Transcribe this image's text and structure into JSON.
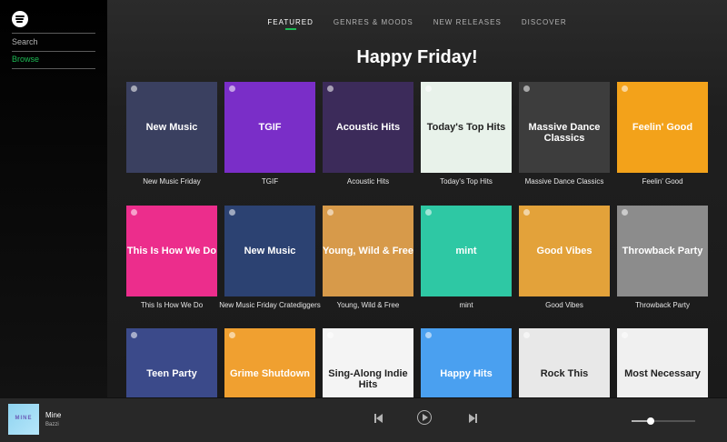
{
  "sidebar": {
    "items": [
      {
        "label": "Search"
      },
      {
        "label": "Browse"
      }
    ]
  },
  "tabs": [
    {
      "label": "FEATURED"
    },
    {
      "label": "GENRES & MOODS"
    },
    {
      "label": "NEW RELEASES"
    },
    {
      "label": "DISCOVER"
    }
  ],
  "heading": "Happy Friday!",
  "playlists": [
    {
      "name": "New Music Friday",
      "cover_text": "New Music",
      "bg": "#3a4060"
    },
    {
      "name": "TGIF",
      "cover_text": "TGIF",
      "bg": "#7a2ec8"
    },
    {
      "name": "Acoustic Hits",
      "cover_text": "Acoustic Hits",
      "bg": "#3c2b5a"
    },
    {
      "name": "Today's Top Hits",
      "cover_text": "Today's Top Hits",
      "bg": "#e8f2ea"
    },
    {
      "name": "Massive Dance Classics",
      "cover_text": "Massive Dance Classics",
      "bg": "#3d3d3d"
    },
    {
      "name": "Feelin' Good",
      "cover_text": "Feelin' Good",
      "bg": "#f3a21a"
    },
    {
      "name": "This Is How We Do",
      "cover_text": "This Is How We Do",
      "bg": "#ec2d8c"
    },
    {
      "name": "New Music Friday Cratediggers",
      "cover_text": "New Music",
      "bg": "#2c4272"
    },
    {
      "name": "Young, Wild & Free",
      "cover_text": "Young, Wild & Free",
      "bg": "#d79a4a"
    },
    {
      "name": "mint",
      "cover_text": "mint",
      "bg": "#2ec8a4"
    },
    {
      "name": "Good Vibes",
      "cover_text": "Good Vibes",
      "bg": "#e3a23a"
    },
    {
      "name": "Throwback Party",
      "cover_text": "Throwback Party",
      "bg": "#8c8c8c"
    },
    {
      "name": "",
      "cover_text": "Teen Party",
      "bg": "#3b4a8a"
    },
    {
      "name": "",
      "cover_text": "Grime Shutdown",
      "bg": "#f0a030"
    },
    {
      "name": "",
      "cover_text": "Sing-Along Indie Hits",
      "bg": "#f4f4f4"
    },
    {
      "name": "",
      "cover_text": "Happy Hits",
      "bg": "#4aa0f0"
    },
    {
      "name": "",
      "cover_text": "Rock This",
      "bg": "#e8e8e8"
    },
    {
      "name": "",
      "cover_text": "Most Necessary",
      "bg": "#f0f0f0"
    }
  ],
  "now_playing": {
    "title": "Mine",
    "artist": "Bazzi",
    "art_text": "MINE"
  },
  "volume": 0.3,
  "colors": {
    "accent": "#1db954"
  },
  "icons": [
    "spotify-logo-icon",
    "previous-track-icon",
    "play-icon",
    "next-track-icon"
  ]
}
